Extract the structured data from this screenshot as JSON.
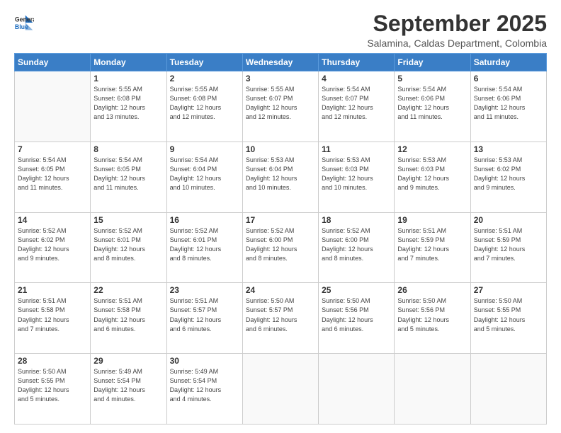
{
  "logo": {
    "line1": "General",
    "line2": "Blue"
  },
  "title": "September 2025",
  "subtitle": "Salamina, Caldas Department, Colombia",
  "days_of_week": [
    "Sunday",
    "Monday",
    "Tuesday",
    "Wednesday",
    "Thursday",
    "Friday",
    "Saturday"
  ],
  "weeks": [
    [
      {
        "day": "",
        "info": ""
      },
      {
        "day": "1",
        "info": "Sunrise: 5:55 AM\nSunset: 6:08 PM\nDaylight: 12 hours\nand 13 minutes."
      },
      {
        "day": "2",
        "info": "Sunrise: 5:55 AM\nSunset: 6:08 PM\nDaylight: 12 hours\nand 12 minutes."
      },
      {
        "day": "3",
        "info": "Sunrise: 5:55 AM\nSunset: 6:07 PM\nDaylight: 12 hours\nand 12 minutes."
      },
      {
        "day": "4",
        "info": "Sunrise: 5:54 AM\nSunset: 6:07 PM\nDaylight: 12 hours\nand 12 minutes."
      },
      {
        "day": "5",
        "info": "Sunrise: 5:54 AM\nSunset: 6:06 PM\nDaylight: 12 hours\nand 11 minutes."
      },
      {
        "day": "6",
        "info": "Sunrise: 5:54 AM\nSunset: 6:06 PM\nDaylight: 12 hours\nand 11 minutes."
      }
    ],
    [
      {
        "day": "7",
        "info": "Sunrise: 5:54 AM\nSunset: 6:05 PM\nDaylight: 12 hours\nand 11 minutes."
      },
      {
        "day": "8",
        "info": "Sunrise: 5:54 AM\nSunset: 6:05 PM\nDaylight: 12 hours\nand 11 minutes."
      },
      {
        "day": "9",
        "info": "Sunrise: 5:54 AM\nSunset: 6:04 PM\nDaylight: 12 hours\nand 10 minutes."
      },
      {
        "day": "10",
        "info": "Sunrise: 5:53 AM\nSunset: 6:04 PM\nDaylight: 12 hours\nand 10 minutes."
      },
      {
        "day": "11",
        "info": "Sunrise: 5:53 AM\nSunset: 6:03 PM\nDaylight: 12 hours\nand 10 minutes."
      },
      {
        "day": "12",
        "info": "Sunrise: 5:53 AM\nSunset: 6:03 PM\nDaylight: 12 hours\nand 9 minutes."
      },
      {
        "day": "13",
        "info": "Sunrise: 5:53 AM\nSunset: 6:02 PM\nDaylight: 12 hours\nand 9 minutes."
      }
    ],
    [
      {
        "day": "14",
        "info": "Sunrise: 5:52 AM\nSunset: 6:02 PM\nDaylight: 12 hours\nand 9 minutes."
      },
      {
        "day": "15",
        "info": "Sunrise: 5:52 AM\nSunset: 6:01 PM\nDaylight: 12 hours\nand 8 minutes."
      },
      {
        "day": "16",
        "info": "Sunrise: 5:52 AM\nSunset: 6:01 PM\nDaylight: 12 hours\nand 8 minutes."
      },
      {
        "day": "17",
        "info": "Sunrise: 5:52 AM\nSunset: 6:00 PM\nDaylight: 12 hours\nand 8 minutes."
      },
      {
        "day": "18",
        "info": "Sunrise: 5:52 AM\nSunset: 6:00 PM\nDaylight: 12 hours\nand 8 minutes."
      },
      {
        "day": "19",
        "info": "Sunrise: 5:51 AM\nSunset: 5:59 PM\nDaylight: 12 hours\nand 7 minutes."
      },
      {
        "day": "20",
        "info": "Sunrise: 5:51 AM\nSunset: 5:59 PM\nDaylight: 12 hours\nand 7 minutes."
      }
    ],
    [
      {
        "day": "21",
        "info": "Sunrise: 5:51 AM\nSunset: 5:58 PM\nDaylight: 12 hours\nand 7 minutes."
      },
      {
        "day": "22",
        "info": "Sunrise: 5:51 AM\nSunset: 5:58 PM\nDaylight: 12 hours\nand 6 minutes."
      },
      {
        "day": "23",
        "info": "Sunrise: 5:51 AM\nSunset: 5:57 PM\nDaylight: 12 hours\nand 6 minutes."
      },
      {
        "day": "24",
        "info": "Sunrise: 5:50 AM\nSunset: 5:57 PM\nDaylight: 12 hours\nand 6 minutes."
      },
      {
        "day": "25",
        "info": "Sunrise: 5:50 AM\nSunset: 5:56 PM\nDaylight: 12 hours\nand 6 minutes."
      },
      {
        "day": "26",
        "info": "Sunrise: 5:50 AM\nSunset: 5:56 PM\nDaylight: 12 hours\nand 5 minutes."
      },
      {
        "day": "27",
        "info": "Sunrise: 5:50 AM\nSunset: 5:55 PM\nDaylight: 12 hours\nand 5 minutes."
      }
    ],
    [
      {
        "day": "28",
        "info": "Sunrise: 5:50 AM\nSunset: 5:55 PM\nDaylight: 12 hours\nand 5 minutes."
      },
      {
        "day": "29",
        "info": "Sunrise: 5:49 AM\nSunset: 5:54 PM\nDaylight: 12 hours\nand 4 minutes."
      },
      {
        "day": "30",
        "info": "Sunrise: 5:49 AM\nSunset: 5:54 PM\nDaylight: 12 hours\nand 4 minutes."
      },
      {
        "day": "",
        "info": ""
      },
      {
        "day": "",
        "info": ""
      },
      {
        "day": "",
        "info": ""
      },
      {
        "day": "",
        "info": ""
      }
    ]
  ]
}
